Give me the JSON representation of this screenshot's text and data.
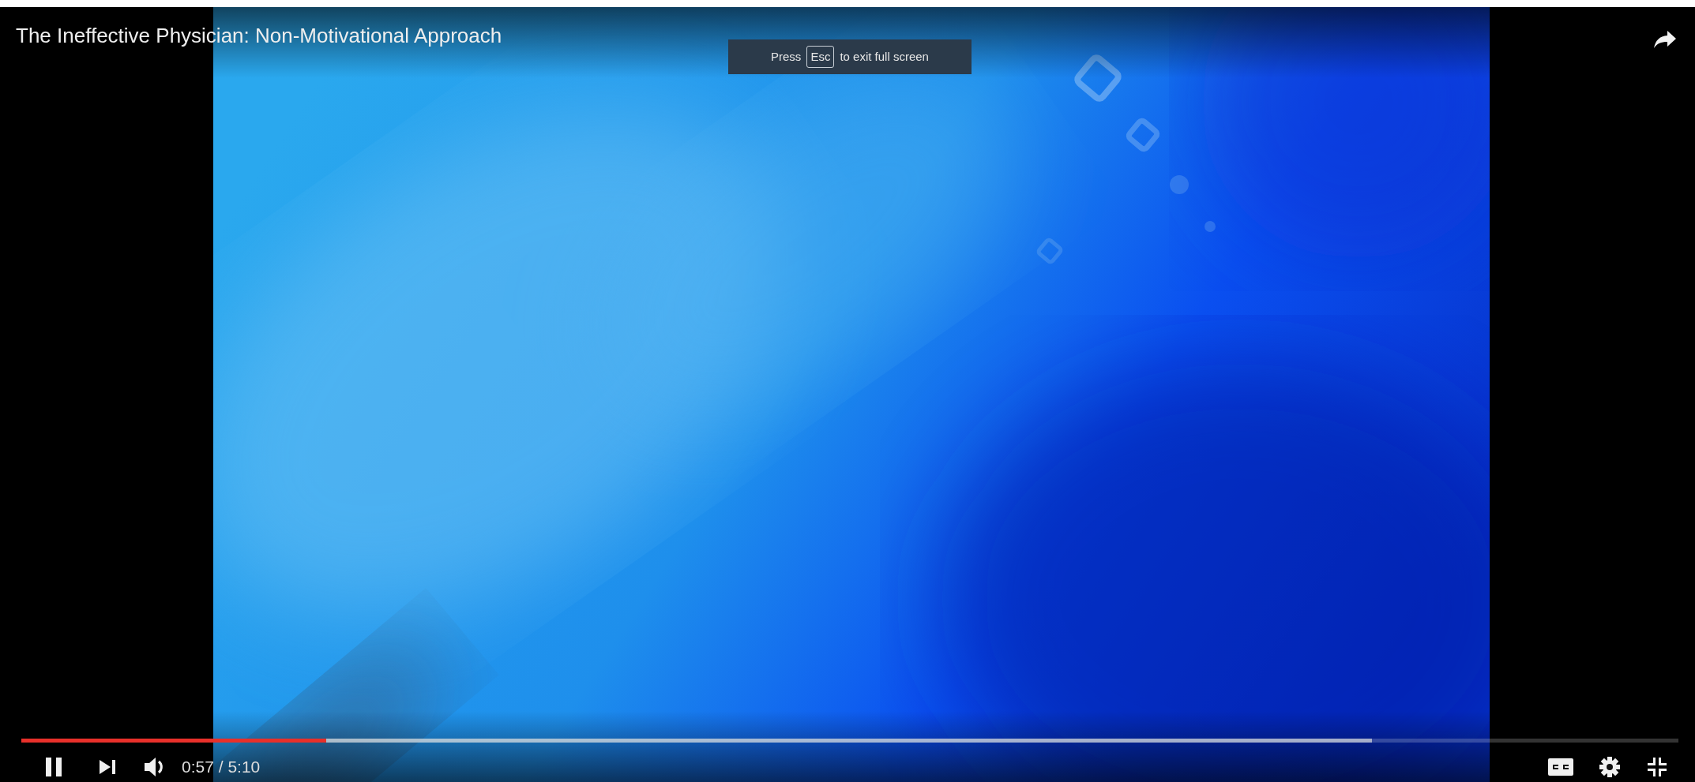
{
  "video": {
    "title": "The Ineffective Physician: Non-Motivational Approach"
  },
  "fullscreen_notice": {
    "before": "Press",
    "key": "Esc",
    "after": "to exit full screen"
  },
  "progress": {
    "level": 0.184
  },
  "buffer": {
    "level": 0.815
  },
  "controls": {
    "playing": true,
    "time": "0:57 / 5:10"
  }
}
